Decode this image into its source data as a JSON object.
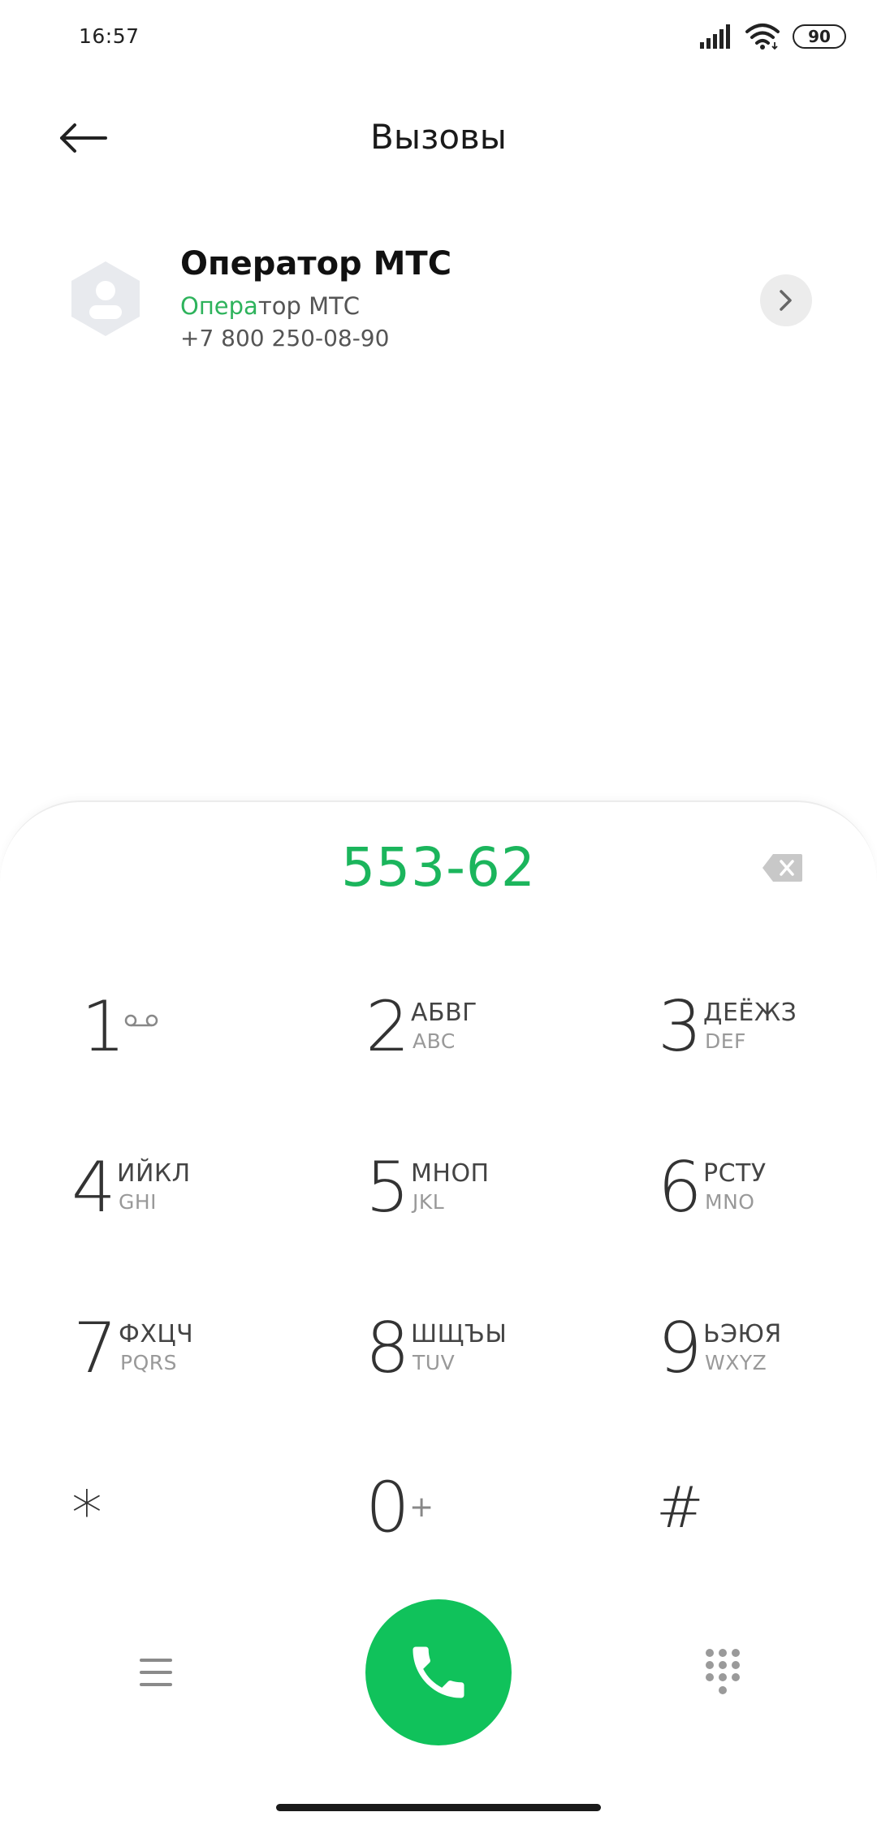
{
  "status_bar": {
    "time": "16:57",
    "battery": "90"
  },
  "header": {
    "title": "Вызовы"
  },
  "contact": {
    "name": "Оператор МТС",
    "sub_highlight": "Опера",
    "sub_rest": "тор МТС",
    "phone": "+7 800 250-08-90"
  },
  "dialer": {
    "number": "553-62",
    "keys": [
      {
        "digit": "1",
        "ru": "",
        "en": ""
      },
      {
        "digit": "2",
        "ru": "АБВГ",
        "en": "ABC"
      },
      {
        "digit": "3",
        "ru": "ДЕЁЖЗ",
        "en": "DEF"
      },
      {
        "digit": "4",
        "ru": "ИЙКЛ",
        "en": "GHI"
      },
      {
        "digit": "5",
        "ru": "МНОП",
        "en": "JKL"
      },
      {
        "digit": "6",
        "ru": "РСТУ",
        "en": "MNO"
      },
      {
        "digit": "7",
        "ru": "ФХЦЧ",
        "en": "PQRS"
      },
      {
        "digit": "8",
        "ru": "ШЩЪЫ",
        "en": "TUV"
      },
      {
        "digit": "9",
        "ru": "ЬЭЮЯ",
        "en": "WXYZ"
      },
      {
        "digit": "*",
        "ru": "",
        "en": ""
      },
      {
        "digit": "0",
        "ru": "",
        "en": "",
        "plus": "+"
      },
      {
        "digit": "#",
        "ru": "",
        "en": ""
      }
    ]
  },
  "colors": {
    "accent_green": "#10c25b",
    "number_green": "#1bb55c"
  },
  "icons": {
    "back": "arrow-left-icon",
    "avatar": "contact-avatar-icon",
    "chevron": "chevron-right-icon",
    "backspace": "backspace-icon",
    "voicemail": "voicemail-icon",
    "menu": "menu-icon",
    "call": "phone-icon",
    "keypad": "keypad-icon"
  }
}
